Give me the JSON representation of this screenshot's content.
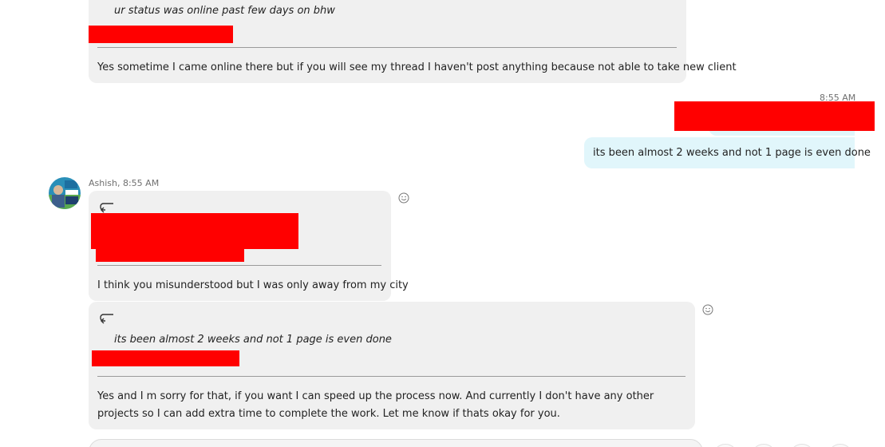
{
  "messages": [
    {
      "id": "m1",
      "quote": "ur status was online past few days on bhw",
      "text": "Yes sometime I came online there but if you will see my thread I haven't post anything because not able to take new client"
    },
    {
      "id": "m2",
      "timestamp": "8:55 AM",
      "text": "its been almost 2 weeks and not 1 page is even done"
    },
    {
      "id": "m3",
      "sender": "Ashish, 8:55 AM",
      "text": "I think you misunderstood but I was only away from my city"
    },
    {
      "id": "m4",
      "quote": "its been almost 2 weeks and not 1 page is even done",
      "text": "Yes and I m sorry for that, if you want I can speed up the process now. And currently I don't have any other projects so I can add extra time to complete the work. Let me know if thats okay for you."
    }
  ],
  "icons": {
    "reply": "reply-arrow-icon",
    "reaction": "smiley-icon"
  },
  "colors": {
    "incoming_bubble": "#f0f0f0",
    "outgoing_bubble": "#e1f6fb",
    "redaction": "#ff0000"
  }
}
